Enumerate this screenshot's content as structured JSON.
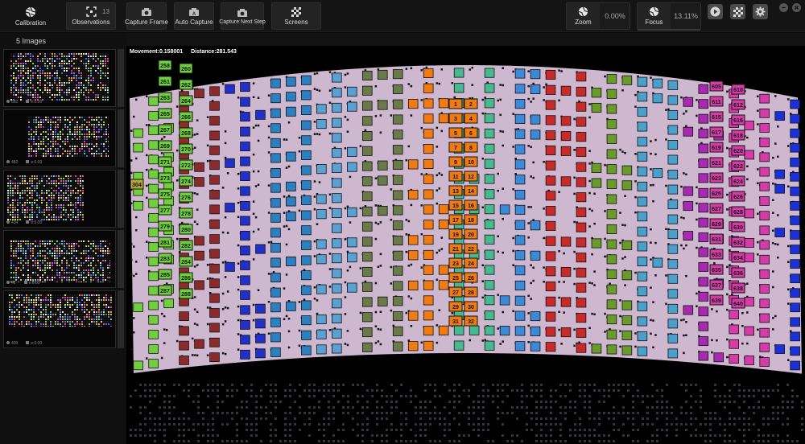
{
  "toolbar": {
    "calibration_label": "Calibration",
    "observations_label": "Observations",
    "observations_count": "13",
    "capture_frame_label": "Capture Frame",
    "auto_capture_label": "Auto Capture",
    "capture_next_step_label": "Capture Next Step",
    "screens_label": "Screens",
    "zoom_label": "Zoom",
    "zoom_value": "0.00%",
    "focus_label": "Focus",
    "focus_value": "13.11%"
  },
  "sidebar": {
    "title": "5 Images",
    "thumbnails": [
      {
        "count": "582",
        "score": "e:0.00"
      },
      {
        "count": "482",
        "score": "e:0.00"
      },
      {
        "count": "434",
        "score": "e:0.00"
      },
      {
        "count": "42",
        "score": "e:0.00"
      },
      {
        "count": "409",
        "score": "e:0.00"
      }
    ]
  },
  "viewport": {
    "movement_text": "Movement:0.158001",
    "distance_text": "Distance:281.543",
    "visible_marker_labels": [
      "258",
      "260",
      "261",
      "262",
      "263",
      "264",
      "265",
      "266",
      "267",
      "268",
      "269",
      "270",
      "271",
      "272",
      "273",
      "274",
      "275",
      "276",
      "277",
      "278",
      "279",
      "280",
      "281",
      "282",
      "283",
      "284",
      "285",
      "286",
      "287",
      "288",
      "304",
      "1",
      "2",
      "3",
      "4",
      "5",
      "6",
      "7",
      "8",
      "9",
      "10",
      "11",
      "12",
      "13",
      "14",
      "15",
      "16",
      "17",
      "18",
      "19",
      "20",
      "21",
      "22",
      "23",
      "24",
      "25",
      "26",
      "27",
      "28",
      "29",
      "30",
      "31",
      "32",
      "605",
      "610",
      "611",
      "612",
      "615",
      "616",
      "617",
      "618",
      "619",
      "620",
      "621",
      "622",
      "623",
      "624",
      "625",
      "626",
      "627",
      "628",
      "629",
      "630",
      "631",
      "632",
      "633",
      "634",
      "635",
      "636",
      "637",
      "638",
      "639",
      "640"
    ]
  },
  "icons": {
    "calibration": "aperture-icon",
    "observations": "focus-frame-icon",
    "capture_frame": "camera-icon",
    "auto_capture": "camera-a-icon",
    "capture_next_step": "camera-icon",
    "screens": "checkerboard-icon",
    "zoom": "aperture-icon",
    "focus": "aperture-icon",
    "play": "play-icon",
    "grid": "checkerboard-icon",
    "settings": "gear-icon"
  },
  "colors": {
    "background": "#000000",
    "toolbar": "#141414",
    "panel": "#101010",
    "button": "#232323",
    "marker_green": "#6fcf3c",
    "marker_orange": "#f07b12",
    "marker_pink": "#d63ca8",
    "marker_olive": "#b6a63a"
  }
}
